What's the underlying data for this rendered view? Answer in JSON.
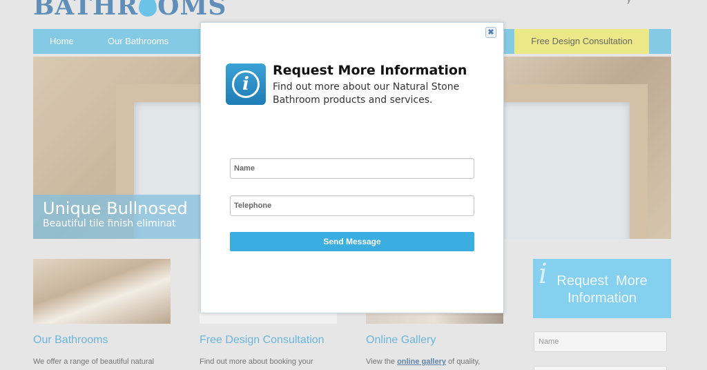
{
  "site": {
    "logo_left": "BATHR",
    "logo_right": "OMS",
    "top_right_text": "y"
  },
  "nav": {
    "items": [
      {
        "label": "Home"
      },
      {
        "label": "Our Bathrooms"
      }
    ],
    "cta_label": "Free Design Consultation"
  },
  "hero": {
    "title": "Unique Bullnosed",
    "subtitle": "Beautiful tile finish eliminat"
  },
  "columns": [
    {
      "title": "Our Bathrooms",
      "text": "We offer a range of beautiful natural"
    },
    {
      "title": "Free Design Consultation",
      "text": "Find out more about booking your"
    },
    {
      "title": "Online Gallery",
      "text_before": "View the",
      "link": "online gallery",
      "text_after": "of quality,"
    }
  ],
  "sidebar": {
    "cta_line1": "Request  More",
    "cta_line2": "Information",
    "name_placeholder": "Name"
  },
  "modal": {
    "title": "Request More Information",
    "description": "Find out more about our Natural Stone Bathroom products and services.",
    "name_placeholder": "Name",
    "telephone_placeholder": "Telephone",
    "send_label": "Send Message",
    "close_glyph": "✖"
  },
  "colors": {
    "accent": "#3aaee0",
    "nav": "#5bb8dc",
    "cta": "#e6e060",
    "heading": "#3a9bcf"
  }
}
